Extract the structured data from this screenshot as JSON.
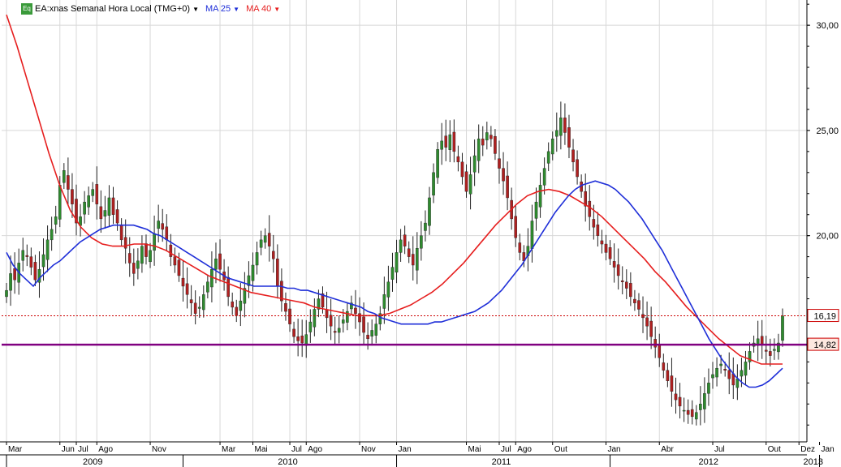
{
  "legend": {
    "badge": "Eq",
    "symbol": "EA:xnas Semanal Hora Local (TMG+0)",
    "ma_short": "MA 25",
    "ma_long": "MA 40",
    "arrow": "▼"
  },
  "colors": {
    "up": "#2e8b2e",
    "down": "#b02020",
    "ma_short": "#1f2fd8",
    "ma_long": "#e61e1e",
    "support": "#800080",
    "last_price": "#cc0000"
  },
  "chart_data": {
    "type": "candlestick",
    "title": "EA:xnas Semanal Hora Local (TMG+0)",
    "ylim": [
      10.2,
      31.2
    ],
    "y_ticks": [
      {
        "value": 30,
        "label": "30,00"
      },
      {
        "value": 25,
        "label": "25,00"
      },
      {
        "value": 20,
        "label": "20,00"
      }
    ],
    "price_markers": [
      {
        "value": 16.19,
        "label": "16,19",
        "style": "dotted-red"
      },
      {
        "value": 14.82,
        "label": "14,82",
        "style": "solid-purple"
      }
    ],
    "month_ticks": [
      {
        "label": "Mar",
        "index": 0
      },
      {
        "label": "Jun",
        "index": 13
      },
      {
        "label": "Jul",
        "index": 17
      },
      {
        "label": "Ago",
        "index": 22
      },
      {
        "label": "Nov",
        "index": 35
      },
      {
        "label": "Mar",
        "index": 52
      },
      {
        "label": "Mai",
        "index": 60
      },
      {
        "label": "Jul",
        "index": 69
      },
      {
        "label": "Ago",
        "index": 73
      },
      {
        "label": "Nov",
        "index": 86
      },
      {
        "label": "Jan",
        "index": 95
      },
      {
        "label": "Mai",
        "index": 112
      },
      {
        "label": "Jul",
        "index": 120
      },
      {
        "label": "Ago",
        "index": 124
      },
      {
        "label": "Out",
        "index": 133
      },
      {
        "label": "Jan",
        "index": 146
      },
      {
        "label": "Abr",
        "index": 159
      },
      {
        "label": "Jul",
        "index": 172
      },
      {
        "label": "Out",
        "index": 185
      },
      {
        "label": "Dez",
        "index": 193
      },
      {
        "label": "Jan",
        "index": 198
      }
    ],
    "year_ticks": [
      {
        "label": "2009",
        "start": 0,
        "end": 42
      },
      {
        "label": "2010",
        "start": 43,
        "end": 94
      },
      {
        "label": "2011",
        "start": 95,
        "end": 146
      },
      {
        "label": "2012",
        "start": 147,
        "end": 197
      },
      {
        "label": "2013",
        "start": 198,
        "end": 200
      }
    ],
    "close": [
      17.4,
      18.2,
      17.9,
      18.7,
      19.3,
      19.0,
      18.5,
      17.9,
      18.4,
      19.1,
      19.8,
      20.3,
      20.9,
      22.4,
      23.1,
      22.2,
      21.5,
      20.6,
      20.9,
      21.6,
      21.9,
      22.2,
      21.5,
      20.8,
      21.2,
      21.8,
      21.0,
      20.6,
      19.8,
      19.4,
      18.7,
      18.2,
      18.8,
      19.5,
      19.0,
      19.3,
      20.1,
      20.7,
      20.3,
      19.8,
      19.0,
      18.6,
      18.1,
      17.6,
      17.2,
      16.8,
      16.3,
      16.6,
      17.2,
      17.8,
      18.4,
      18.9,
      18.4,
      17.9,
      17.1,
      16.6,
      16.2,
      16.9,
      17.5,
      18.1,
      18.6,
      19.2,
      19.8,
      20.0,
      19.5,
      18.9,
      17.6,
      16.9,
      16.4,
      15.8,
      15.2,
      15.0,
      14.9,
      15.3,
      15.9,
      16.5,
      17.0,
      16.6,
      16.1,
      15.7,
      15.4,
      15.6,
      16.0,
      16.4,
      16.8,
      16.3,
      15.9,
      15.4,
      15.1,
      15.5,
      15.8,
      16.3,
      17.2,
      17.8,
      18.5,
      19.2,
      19.8,
      19.5,
      19.0,
      18.6,
      19.4,
      20.0,
      20.6,
      21.8,
      23.0,
      24.1,
      24.5,
      24.2,
      24.8,
      24.0,
      23.5,
      22.8,
      22.1,
      22.9,
      23.8,
      24.6,
      24.3,
      24.9,
      24.6,
      23.9,
      23.2,
      22.6,
      21.8,
      20.8,
      19.9,
      19.2,
      18.8,
      19.5,
      20.7,
      21.6,
      22.4,
      23.2,
      24.0,
      24.6,
      25.0,
      25.6,
      24.9,
      24.2,
      23.5,
      22.8,
      22.1,
      21.4,
      20.9,
      20.4,
      20.0,
      19.6,
      19.2,
      18.9,
      18.5,
      18.1,
      17.8,
      17.5,
      17.1,
      16.8,
      16.5,
      16.1,
      15.7,
      15.2,
      14.7,
      14.2,
      13.6,
      13.1,
      12.6,
      12.2,
      11.9,
      11.7,
      11.5,
      11.4,
      11.6,
      12.0,
      12.5,
      13.0,
      13.4,
      13.7,
      13.9,
      13.6,
      13.2,
      12.9,
      13.2,
      13.6,
      14.0,
      14.5,
      14.9,
      15.1,
      14.8,
      14.5,
      14.3,
      14.6,
      14.9,
      16.19
    ],
    "ma_25": [
      19.2,
      18.6,
      18.2,
      17.9,
      17.6,
      18.0,
      18.3,
      18.6,
      18.8,
      19.1,
      19.4,
      19.7,
      19.9,
      20.1,
      20.3,
      20.4,
      20.5,
      20.5,
      20.5,
      20.5,
      20.4,
      20.3,
      20.1,
      20.0,
      19.8,
      19.6,
      19.4,
      19.2,
      19.0,
      18.8,
      18.6,
      18.4,
      18.2,
      18.0,
      17.9,
      17.8,
      17.7,
      17.6,
      17.6,
      17.6,
      17.6,
      17.6,
      17.5,
      17.5,
      17.4,
      17.4,
      17.3,
      17.2,
      17.1,
      17.0,
      16.9,
      16.8,
      16.7,
      16.6,
      16.4,
      16.3,
      16.1,
      16.0,
      15.9,
      15.8,
      15.8,
      15.8,
      15.8,
      15.8,
      15.9,
      15.9,
      16.0,
      16.1,
      16.2,
      16.3,
      16.4,
      16.6,
      16.8,
      17.1,
      17.4,
      17.8,
      18.2,
      18.6,
      19.1,
      19.6,
      20.1,
      20.6,
      21.1,
      21.5,
      21.9,
      22.2,
      22.4,
      22.5,
      22.6,
      22.5,
      22.4,
      22.2,
      21.9,
      21.6,
      21.2,
      20.8,
      20.3,
      19.8,
      19.3,
      18.7,
      18.1,
      17.5,
      16.9,
      16.3,
      15.7,
      15.1,
      14.6,
      14.1,
      13.7,
      13.3,
      13.0,
      12.8,
      12.8,
      12.9,
      13.1,
      13.4,
      13.7
    ],
    "ma_40": [
      30.5,
      29.0,
      27.3,
      25.6,
      23.9,
      22.4,
      21.2,
      20.4,
      19.9,
      19.6,
      19.5,
      19.5,
      19.6,
      19.6,
      19.5,
      19.3,
      19.0,
      18.7,
      18.4,
      18.1,
      17.9,
      17.7,
      17.5,
      17.3,
      17.2,
      17.1,
      17.0,
      16.9,
      16.8,
      16.6,
      16.5,
      16.4,
      16.3,
      16.2,
      16.2,
      16.2,
      16.3,
      16.5,
      16.7,
      17.0,
      17.3,
      17.7,
      18.2,
      18.7,
      19.3,
      19.9,
      20.5,
      21.0,
      21.5,
      21.9,
      22.1,
      22.2,
      22.1,
      21.9,
      21.6,
      21.3,
      20.9,
      20.4,
      19.9,
      19.4,
      18.9,
      18.3,
      17.8,
      17.2,
      16.6,
      16.1,
      15.6,
      15.1,
      14.7,
      14.3,
      14.1,
      13.9,
      13.9,
      13.9
    ]
  },
  "axis": {
    "y_labels": [
      "30,00",
      "25,00",
      "20,00"
    ],
    "marker_last": "16,19",
    "marker_support": "14,82"
  }
}
